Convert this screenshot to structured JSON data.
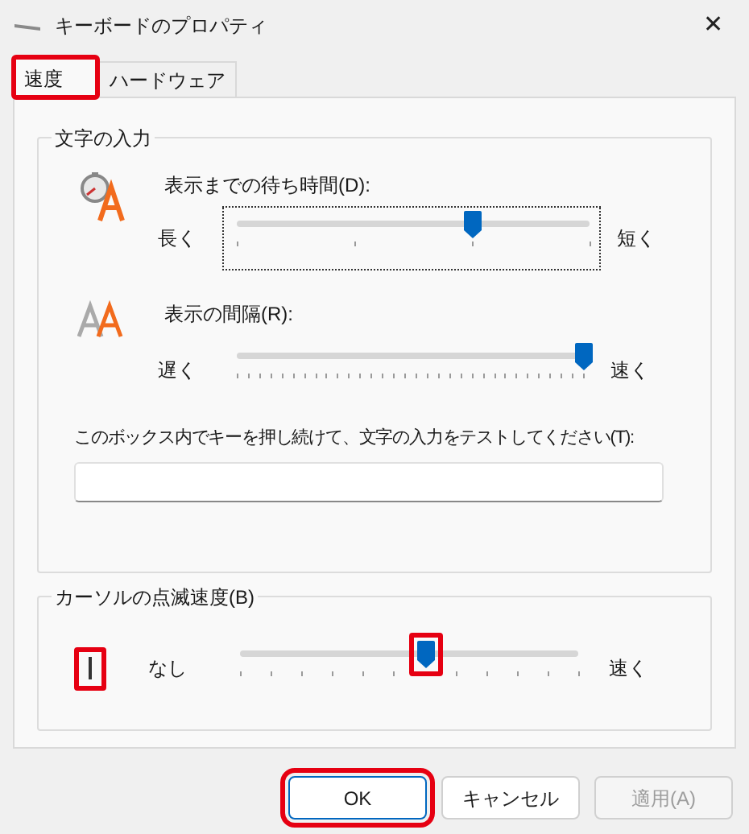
{
  "window": {
    "title": "キーボードのプロパティ",
    "close": "✕"
  },
  "tabs": [
    {
      "label": "速度",
      "selected": true,
      "highlighted": true
    },
    {
      "label": "ハードウェア",
      "selected": false,
      "highlighted": false
    }
  ],
  "typing": {
    "title": "文字の入力",
    "delay": {
      "label": "表示までの待ち時間(D):",
      "left": "長く",
      "right": "短く",
      "level": 0.67,
      "focused": true
    },
    "rate": {
      "label": "表示の間隔(R):",
      "left": "遅く",
      "right": "速く",
      "level": 1,
      "focused": false
    },
    "test": {
      "label": "このボックス内でキーを押し続けて、文字の入力をテストしてください(T):"
    }
  },
  "cursor": {
    "title": "カーソルの点滅速度(B)",
    "icon_highlighted": true,
    "left": "なし",
    "right": "速く",
    "level": 0.55,
    "thumb_highlighted": true
  },
  "buttons": [
    {
      "label": "OK",
      "kind": "default",
      "disabled": false,
      "highlighted": true
    },
    {
      "label": "キャンセル",
      "kind": "normal",
      "disabled": false,
      "highlighted": false
    },
    {
      "label": "適用(A)",
      "kind": "normal",
      "disabled": true,
      "highlighted": false
    }
  ]
}
